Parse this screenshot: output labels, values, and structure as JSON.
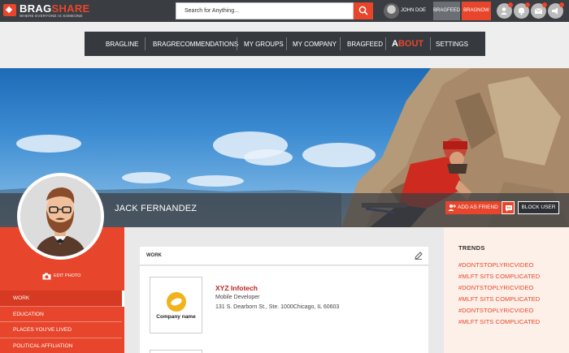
{
  "header": {
    "logo": {
      "brand_a": "BRAG",
      "brand_b": "SHARE",
      "tagline": "WHERE EVERYONE IS SOMEONE"
    },
    "search_placeholder": "Search for Anything...",
    "user_name": "JOHN DOE",
    "bragfeed_label": "BRAGFEED",
    "bragnow_label": "BRAGNOW",
    "icons": [
      "add-friend-icon",
      "notification-icon",
      "mail-icon",
      "alert-icon"
    ]
  },
  "nav": {
    "items": [
      "BRAGLINE",
      "BRAGRECOMMENDATIONS",
      "MY GROUPS",
      "MY COMPANY",
      "BRAGFEED",
      "ABOUT",
      "SETTINGS"
    ],
    "about_first": "A",
    "about_rest": "BOUT"
  },
  "profile": {
    "name": "JACK FERNANDEZ",
    "add_friend_label": "ADD AS FRIEND",
    "block_user_label": "BLOCK USER",
    "edit_photo_label": "EDIT PHOTO"
  },
  "sidebar": {
    "items": [
      {
        "label": "WORK",
        "active": true
      },
      {
        "label": "EDUCATION",
        "active": false
      },
      {
        "label": "PLACES YOU'VE LIVED",
        "active": false
      },
      {
        "label": "POLITICAL AFFILIATION",
        "active": false
      }
    ]
  },
  "work": {
    "section_title": "WORK",
    "logo_text": "Company name",
    "company": "XYZ Infotech",
    "title": "Mobile Developer",
    "address": "131 S. Dearborn St., Ste. 1000Chicago, IL 60603"
  },
  "trends": {
    "title": "TRENDS",
    "items": [
      "#DONTSTOPLYRICVIDEO",
      "#MLFT SITS COMPLICATED",
      "#DONTSTOPLYRICVIDEO",
      "#MLFT SITS COMPLICATED",
      "#DONTSTOPLYRICVIDEO",
      "#MLFT SITS COMPLICATED"
    ]
  },
  "colors": {
    "accent": "#e8462c",
    "dark": "#3a3d42",
    "trend_bg": "#fdf0e8"
  }
}
